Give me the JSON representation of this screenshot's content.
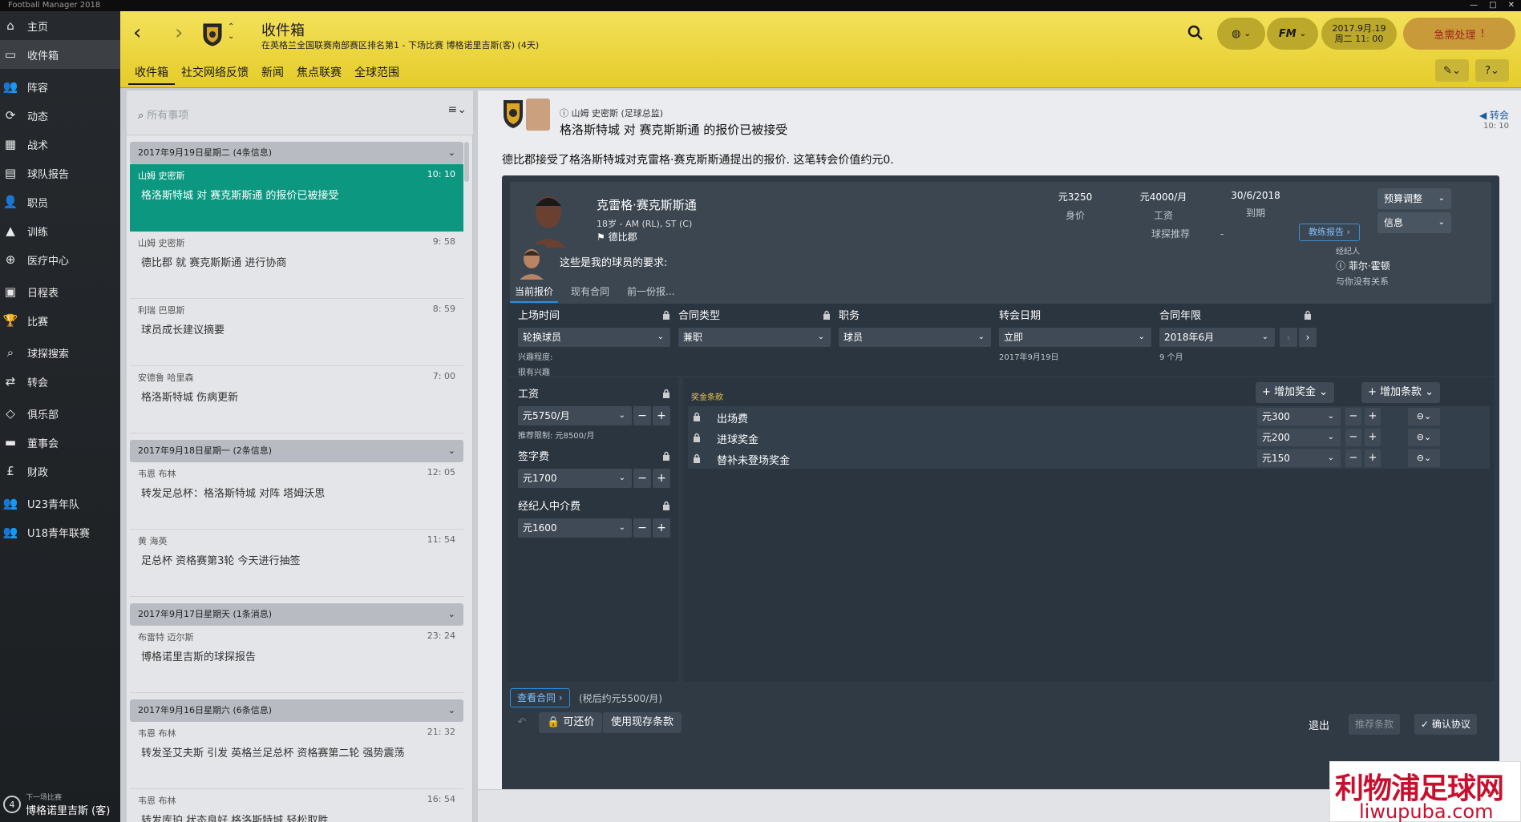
{
  "os": {
    "title": "Football Manager 2018"
  },
  "sidebar": {
    "items": [
      {
        "label": "主页",
        "icon": "home-icon"
      },
      {
        "label": "收件箱",
        "icon": "inbox-icon"
      },
      {
        "label": "阵容",
        "icon": "squad-icon"
      },
      {
        "label": "动态",
        "icon": "dynamics-icon"
      },
      {
        "label": "战术",
        "icon": "tactics-icon"
      },
      {
        "label": "球队报告",
        "icon": "team-report-icon"
      },
      {
        "label": "职员",
        "icon": "staff-icon"
      },
      {
        "label": "训练",
        "icon": "training-icon"
      },
      {
        "label": "医疗中心",
        "icon": "medical-icon"
      },
      {
        "label": "日程表",
        "icon": "calendar-icon"
      },
      {
        "label": "比赛",
        "icon": "trophy-icon"
      },
      {
        "label": "球探搜索",
        "icon": "search-icon"
      },
      {
        "label": "转会",
        "icon": "transfer-icon"
      },
      {
        "label": "俱乐部",
        "icon": "club-icon"
      },
      {
        "label": "董事会",
        "icon": "board-icon"
      },
      {
        "label": "财政",
        "icon": "finance-icon"
      },
      {
        "label": "U23青年队",
        "icon": "u23-icon"
      },
      {
        "label": "U18青年联赛",
        "icon": "u18-icon"
      }
    ],
    "next_match": {
      "label": "下一场比赛",
      "opponent": "博格诺里吉斯 (客)",
      "count": "4"
    }
  },
  "header": {
    "title": "收件箱",
    "subtitle": "在英格兰全国联赛南部赛区排名第1 - 下场比赛  博格诺里吉斯(客) (4天)",
    "tabs": [
      "收件箱",
      "社交网络反馈",
      "新闻",
      "焦点联赛",
      "全球范围"
    ],
    "date_line1": "2017.9月.19",
    "date_line2": "周二 11: 00",
    "urgent": "急需处理",
    "fm_label": "FM"
  },
  "inbox": {
    "search_placeholder": "所有事项",
    "groups": [
      {
        "header": "2017年9月19日星期二 (4条信息)",
        "messages": [
          {
            "from": "山姆 史密斯",
            "time": "10: 10",
            "subject": "格洛斯特城 对 赛克斯斯通 的报价已被接受",
            "active": true
          },
          {
            "from": "山姆 史密斯",
            "time": "9: 58",
            "subject": "德比郡 就 赛克斯斯通 进行协商"
          },
          {
            "from": "利瑞 巴恩斯",
            "time": "8: 59",
            "subject": "球员成长建议摘要"
          },
          {
            "from": "安德鲁 哈里森",
            "time": "7: 00",
            "subject": "格洛斯特城 伤病更新"
          }
        ]
      },
      {
        "header": "2017年9月18日星期一 (2条信息)",
        "messages": [
          {
            "from": "韦恩 布林",
            "time": "12: 05",
            "subject": "转发足总杯：格洛斯特城 对阵 塔姆沃思"
          },
          {
            "from": "黄 海英",
            "time": "11: 54",
            "subject": "足总杯 资格赛第3轮 今天进行抽签"
          }
        ]
      },
      {
        "header": "2017年9月17日星期天 (1条消息)",
        "messages": [
          {
            "from": "布雷特 迈尔斯",
            "time": "23: 24",
            "subject": "博格诺里吉斯的球探报告"
          }
        ]
      },
      {
        "header": "2017年9月16日星期六 (6条信息)",
        "messages": [
          {
            "from": "韦恩 布林",
            "time": "21: 32",
            "subject": "转发圣艾夫斯 引发 英格兰足总杯 资格赛第二轮 强势震荡"
          },
          {
            "from": "韦恩 布林",
            "time": "16: 54",
            "subject": "转发库珀 状态良好 格洛斯特城 轻松取胜"
          }
        ]
      }
    ]
  },
  "message": {
    "from": "山姆 史密斯 (足球总监)",
    "subject": "格洛斯特城 对 赛克斯斯通 的报价已被接受",
    "category": "转会",
    "time": "10: 10",
    "body": "德比郡接受了格洛斯特城对克雷格·赛克斯斯通提出的报价. 这笔转会价值约元0."
  },
  "player": {
    "name": "克雷格·赛克斯斯通",
    "info": "18岁 - AM (RL), ST (C)",
    "club": "德比郡",
    "value": "元3250",
    "value_label": "身价",
    "wage": "元4000/月",
    "wage_label": "工资",
    "expiry": "30/6/2018",
    "expiry_label": "到期",
    "scout_label": "球探推荐",
    "scout_value": "-",
    "coach_report": "教练报告",
    "budget_btn": "预算调整",
    "info_btn": "信息"
  },
  "request": {
    "text": "这些是我的球员的要求:"
  },
  "agent": {
    "title": "经纪人",
    "name": "菲尔·霍顿",
    "relation": "与你没有关系"
  },
  "offer_tabs": [
    "当前报价",
    "现有合同",
    "前一份报..."
  ],
  "terms": {
    "playing_time": {
      "label": "上场时间",
      "value": "轮换球员",
      "sub1": "兴趣程度:",
      "sub2": "很有兴趣"
    },
    "contract_type": {
      "label": "合同类型",
      "value": "兼职"
    },
    "role": {
      "label": "职务",
      "value": "球员"
    },
    "transfer_date": {
      "label": "转会日期",
      "value": "立即",
      "sub": "2017年9月19日"
    },
    "contract_length": {
      "label": "合同年限",
      "value": "2018年6月",
      "sub": "9 个月"
    }
  },
  "money": {
    "wage": {
      "label": "工资",
      "value": "元5750/月",
      "sub": "推荐限制: 元8500/月"
    },
    "signing_fee": {
      "label": "签字费",
      "value": "元1700"
    },
    "agent_fee": {
      "label": "经纪人中介费",
      "value": "元1600"
    }
  },
  "bonuses": {
    "title": "奖金条款",
    "add_bonus": "增加奖金",
    "add_clause": "增加条款",
    "rows": [
      {
        "label": "出场费",
        "value": "元300"
      },
      {
        "label": "进球奖金",
        "value": "元200"
      },
      {
        "label": "替补未登场奖金",
        "value": "元150"
      }
    ]
  },
  "footer": {
    "view_contract": "查看合同",
    "net": "(税后约元5500/月)",
    "negotiable": "可还价",
    "use_existing": "使用现存条款",
    "exit": "退出",
    "propose": "推荐条款",
    "confirm": "确认协议"
  },
  "watermark": {
    "brand": "利物浦足球网",
    "url": "liwupuba.com"
  }
}
